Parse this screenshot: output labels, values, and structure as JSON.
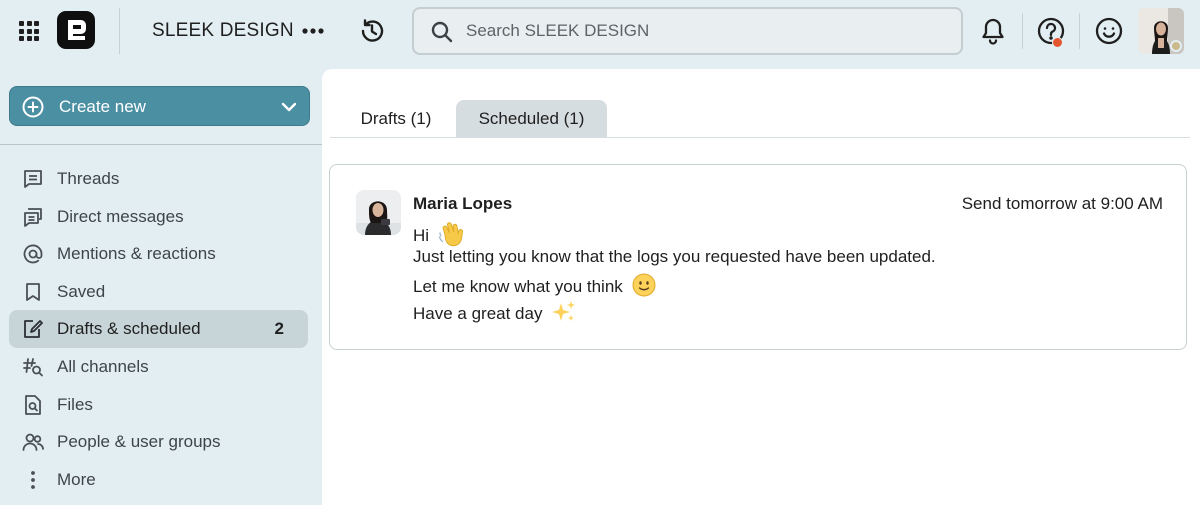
{
  "workspace": {
    "name": "SLEEK DESIGN"
  },
  "search": {
    "placeholder": "Search SLEEK DESIGN"
  },
  "sidebar": {
    "create_label": "Create new",
    "items": [
      {
        "label": "Threads",
        "icon": "threads-icon"
      },
      {
        "label": "Direct messages",
        "icon": "direct-messages-icon"
      },
      {
        "label": "Mentions & reactions",
        "icon": "at-icon"
      },
      {
        "label": "Saved",
        "icon": "bookmark-icon"
      },
      {
        "label": "Drafts & scheduled",
        "icon": "draft-icon",
        "count": "2",
        "active": true
      },
      {
        "label": "All channels",
        "icon": "channel-search-icon"
      },
      {
        "label": "Files",
        "icon": "file-search-icon"
      },
      {
        "label": "People & user groups",
        "icon": "people-icon"
      },
      {
        "label": "More",
        "icon": "more-vertical-icon"
      }
    ]
  },
  "tabs": [
    {
      "label": "Drafts (1)",
      "active": false
    },
    {
      "label": "Scheduled (1)",
      "active": true
    }
  ],
  "message": {
    "sender": "Maria Lopes",
    "schedule": "Send tomorrow at 9:00 AM",
    "lines": [
      "Hi",
      "Just letting you know that the logs you requested have been updated.",
      "Let me know what you think",
      "Have a great day"
    ]
  },
  "colors": {
    "accent": "#4b8fa3",
    "background": "#e3eef2",
    "active_item": "#c7d4d8",
    "notification_dot": "#e4572e"
  }
}
